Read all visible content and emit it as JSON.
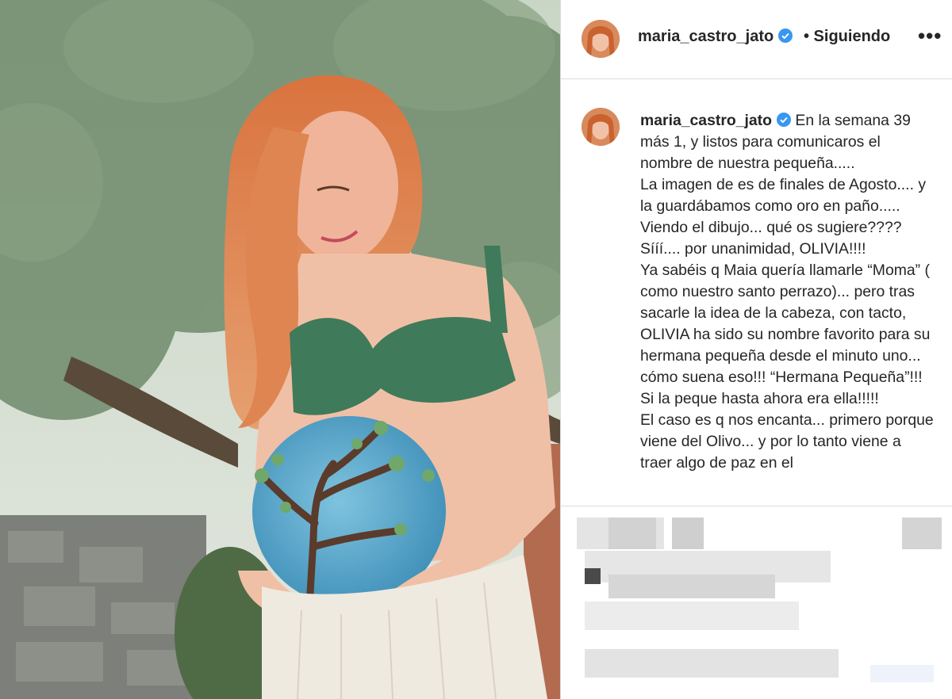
{
  "post": {
    "username": "maria_castro_jato",
    "follow_status": "• Siguiendo",
    "more_icon": "more-horizontal-icon",
    "verified_icon": "verified-badge-icon",
    "verified_color": "#3897f0"
  },
  "caption": {
    "username": "maria_castro_jato",
    "lines": [
      "En la semana 39 más 1, y listos para comunicaros el nombre de nuestra pequeña.....",
      "La imagen de es de finales de Agosto.... y la guardábamos como oro en paño.....",
      "Viendo el dibujo... qué os sugiere????",
      "Sííí.... por unanimidad, OLIVIA!!!!",
      "Ya sabéis q Maia quería llamarle “Moma” ( como nuestro santo perrazo)... pero tras sacarle la idea de la cabeza, con tacto, OLIVIA ha sido su nombre favorito para su hermana pequeña desde el minuto uno... cómo suena eso!!! “Hermana Pequeña”!!! Si la peque hasta ahora era ella!!!!!",
      "El caso es q nos encanta... primero porque viene del Olivo... y por lo tanto viene a traer algo de paz en el"
    ]
  },
  "photo": {
    "subject": "photo"
  },
  "colors": {
    "text": "#262626",
    "border": "#dbdbdb"
  }
}
